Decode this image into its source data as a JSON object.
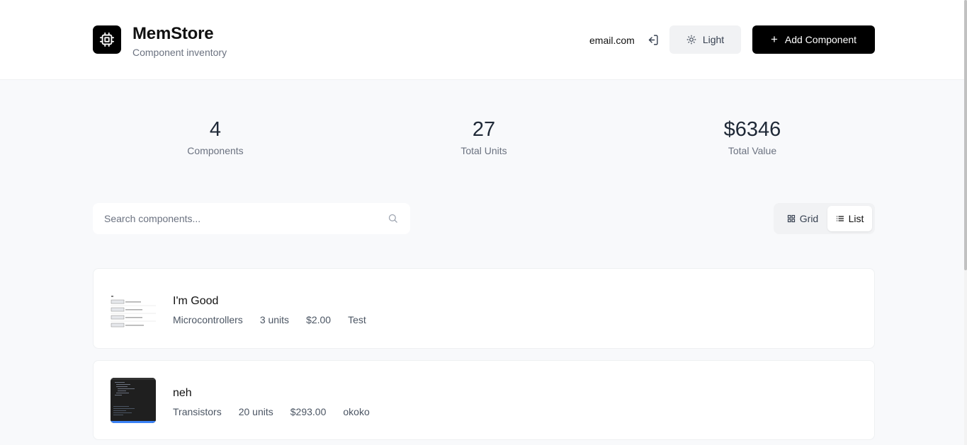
{
  "header": {
    "title": "MemStore",
    "subtitle": "Component inventory",
    "email": "email.com",
    "theme_label": "Light",
    "add_label": "Add Component"
  },
  "stats": [
    {
      "value": "4",
      "label": "Components"
    },
    {
      "value": "27",
      "label": "Total Units"
    },
    {
      "value": "$6346",
      "label": "Total Value"
    }
  ],
  "search": {
    "placeholder": "Search components...",
    "value": ""
  },
  "view_toggle": {
    "grid_label": "Grid",
    "list_label": "List",
    "selected": "List"
  },
  "components": [
    {
      "name": "I'm Good",
      "category": "Microcontrollers",
      "units": "3 units",
      "price": "$2.00",
      "location": "Test"
    },
    {
      "name": "neh",
      "category": "Transistors",
      "units": "20 units",
      "price": "$293.00",
      "location": "okoko"
    }
  ],
  "icons": {
    "logo": "cpu-chip-icon",
    "logout": "log-in-icon",
    "theme": "sun-icon",
    "add": "plus-icon",
    "search": "search-icon",
    "grid": "grid-icon",
    "list": "list-icon"
  },
  "colors": {
    "primary": "#000000",
    "background": "#f8f9fb",
    "muted_text": "#6b7280"
  }
}
